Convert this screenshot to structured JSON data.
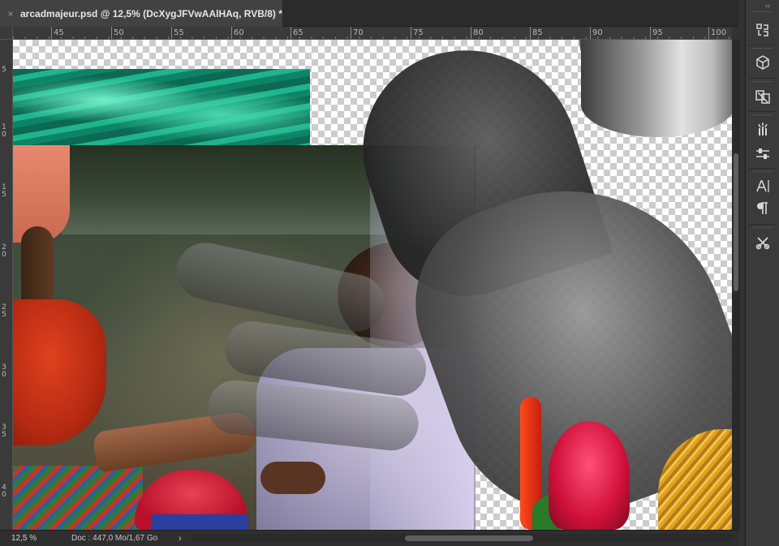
{
  "document": {
    "tab_title": "arcadmajeur.psd @ 12,5% (DcXygJFVwAAlHAq, RVB/8) *",
    "close_glyph": "×"
  },
  "ruler": {
    "top_ticks": [
      "45",
      "50",
      "55",
      "60",
      "65",
      "70",
      "75",
      "80",
      "85",
      "90",
      "95",
      "100"
    ],
    "left_ticks": [
      "5",
      "1\n0",
      "1\n5",
      "2\n0",
      "2\n5",
      "3\n0",
      "3\n5",
      "4\n0"
    ]
  },
  "status": {
    "zoom": "12,5 %",
    "doc_info": "Doc : 447,0 Mo/1,67 Go",
    "arrow": "›"
  },
  "panel": {
    "collapse_glyph": "‹‹",
    "buttons": [
      {
        "icon": "history-icon"
      },
      {
        "icon": "3d-icon"
      },
      {
        "icon": "layer-comps-icon"
      },
      {
        "icon": "brushes-icon"
      },
      {
        "icon": "adjustments-icon"
      },
      {
        "icon": "character-icon"
      },
      {
        "icon": "paragraph-icon"
      },
      {
        "icon": "tool-presets-icon"
      }
    ]
  },
  "colors": {
    "app_bg": "#323232",
    "panel_bg": "#3a3a3a",
    "tab_active": "#424242"
  }
}
